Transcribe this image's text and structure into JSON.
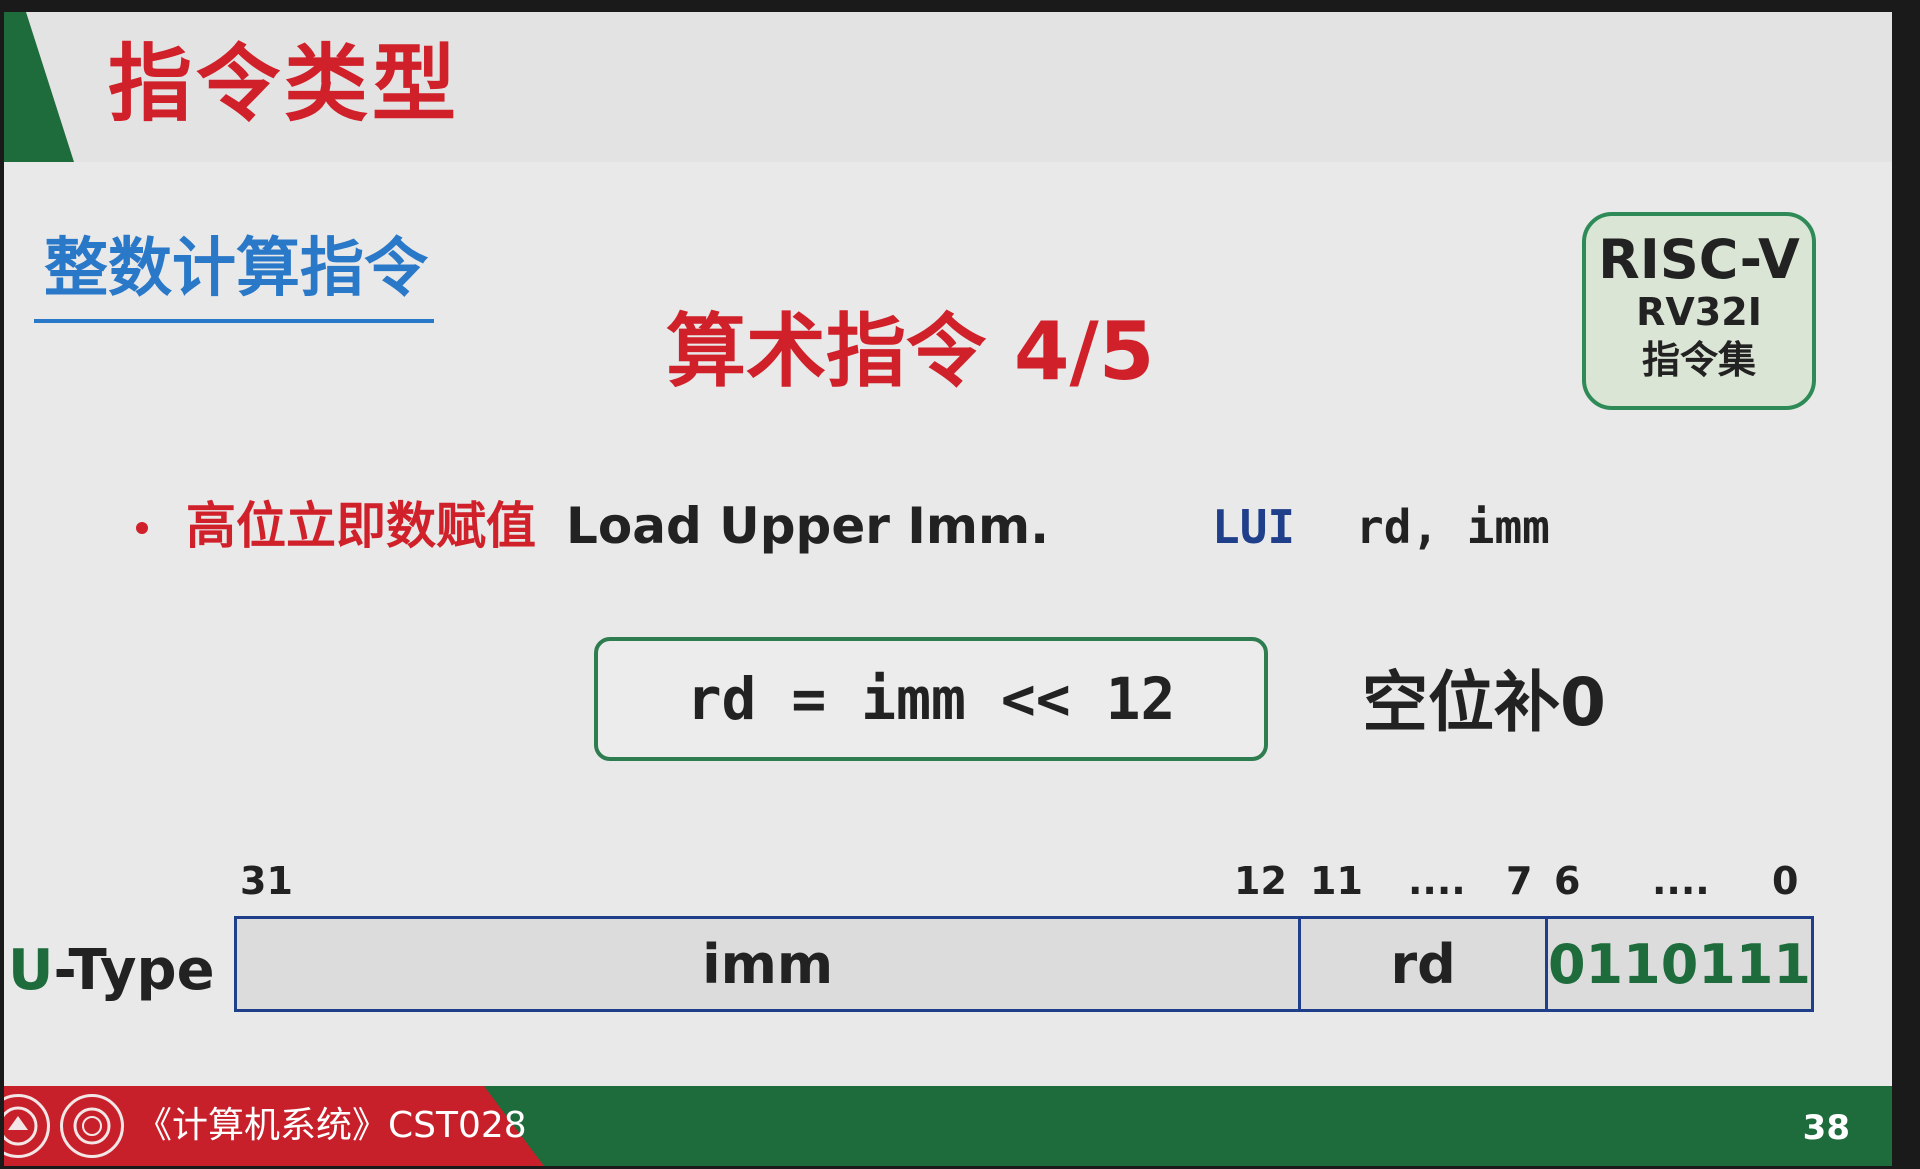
{
  "page_title": "指令类型",
  "section_title": "整数计算指令",
  "sub_title": "算术指令 4/5",
  "badge": {
    "title": "RISC-V",
    "line1": "RV32I",
    "line2": "指令集"
  },
  "bullet": {
    "cn_label": "高位立即数赋值",
    "en_label": "Load Upper Imm.",
    "mnemonic": "LUI",
    "operands": "rd, imm"
  },
  "formula": "rd = imm << 12",
  "fill_note": "空位补0",
  "encoding": {
    "type_prefix": "U",
    "type_suffix": "-Type",
    "bit_labels": [
      "31",
      "12",
      "11",
      "....",
      "7",
      "6",
      "....",
      "0"
    ],
    "fields": {
      "imm": "imm",
      "rd": "rd",
      "opcode": "0110111"
    }
  },
  "footer": {
    "course": "《计算机系统》CST028",
    "page_number": "38"
  },
  "colors": {
    "title_red": "#d0202a",
    "section_blue": "#2a79c9",
    "accent_green": "#1e6b3c",
    "field_border": "#1f3f8a"
  }
}
